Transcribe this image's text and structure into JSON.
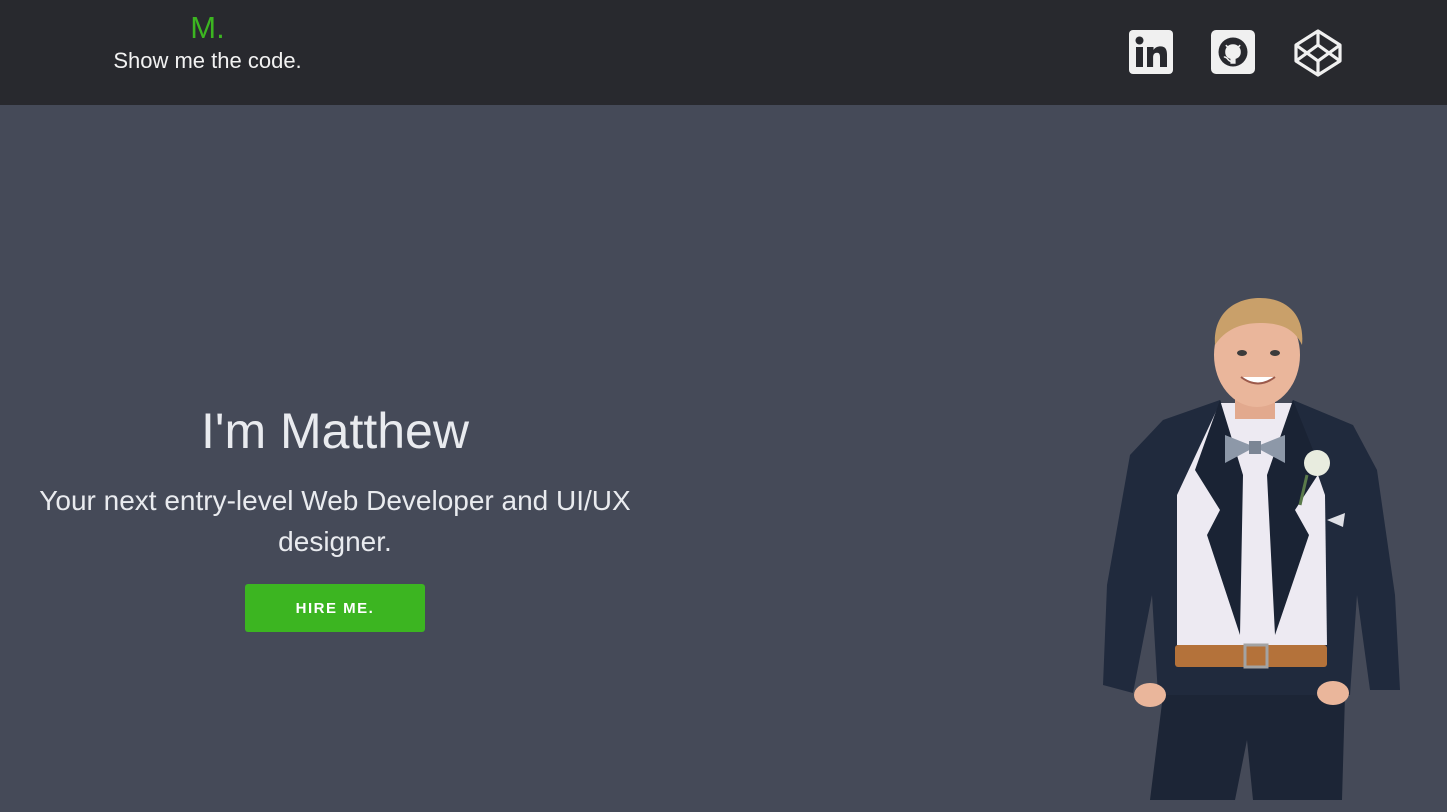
{
  "header": {
    "brand_mark": "M.",
    "tagline": "Show me the code.",
    "social": [
      {
        "name": "LinkedIn",
        "icon": "linkedin-icon"
      },
      {
        "name": "GitHub",
        "icon": "github-icon"
      },
      {
        "name": "CodePen",
        "icon": "codepen-icon"
      }
    ]
  },
  "hero": {
    "title": "I'm Matthew",
    "subtitle": "Your next entry-level Web Developer and UI/UX designer.",
    "cta_label": "HIRE ME.",
    "portrait": "portrait-photo"
  },
  "colors": {
    "accent": "#3cb521",
    "header_bg": "#28292e",
    "hero_bg": "#454a58",
    "text": "#e9ebef"
  }
}
